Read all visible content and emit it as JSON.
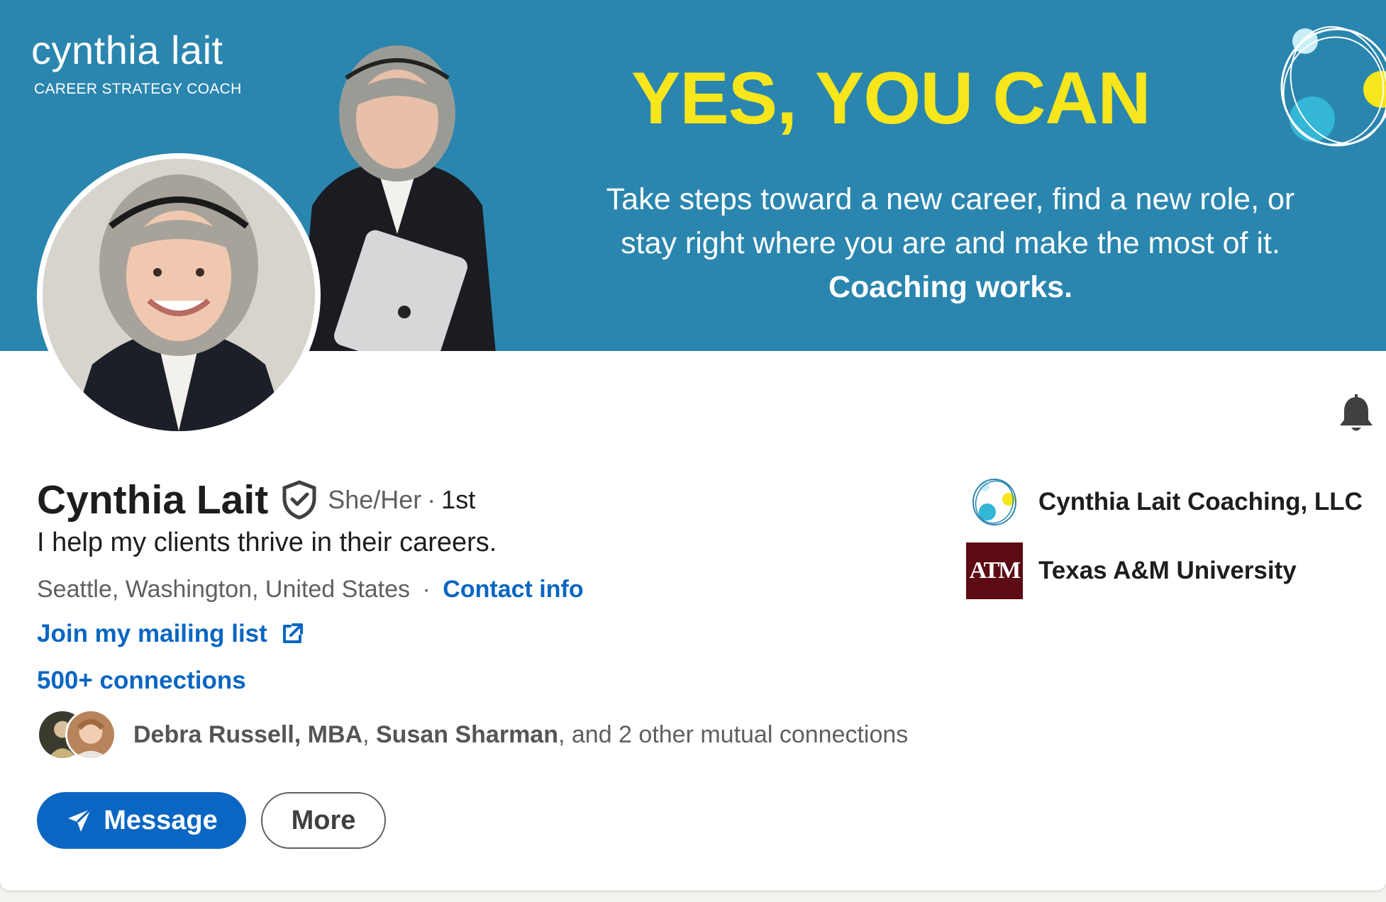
{
  "banner": {
    "brand_name": "cynthia lait",
    "brand_tagline": "CAREER STRATEGY COACH",
    "headline": "YES, YOU CAN",
    "tagline_line1": "Take steps toward a new career, find a new role, or",
    "tagline_line2": "stay right where you are and make the most of it.",
    "tagline_strong": "Coaching works."
  },
  "profile": {
    "name": "Cynthia Lait",
    "pronouns": "She/Her",
    "separator": "·",
    "degree": "1st",
    "headline": "I help my clients thrive in their careers.",
    "location": "Seattle, Washington, United States",
    "contact_info": "Contact info",
    "mailing_list": "Join my mailing list",
    "connections": "500+ connections",
    "mutual_name_1": "Debra Russell, MBA",
    "mutual_name_2": "Susan Sharman",
    "mutual_rest": ", and 2 other mutual connections"
  },
  "actions": {
    "message": "Message",
    "more": "More"
  },
  "orgs": {
    "company": "Cynthia Lait Coaching, LLC",
    "school": "Texas A&M University",
    "school_logo_text": "ATM"
  },
  "colors": {
    "banner_bg": "#2a86ae",
    "headline_yellow": "#f6e61b",
    "link_blue": "#0a66c2",
    "tamu_maroon": "#5c0a13"
  },
  "icons": [
    "verified-shield-icon",
    "bell-icon",
    "external-link-icon",
    "send-icon"
  ]
}
